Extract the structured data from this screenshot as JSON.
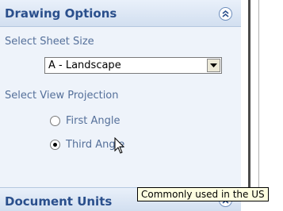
{
  "panel": {
    "title": "Drawing Options",
    "sheet_size": {
      "label": "Select Sheet Size",
      "selected": "A - Landscape"
    },
    "view_projection": {
      "label": "Select View Projection",
      "options": [
        {
          "label": "First Angle",
          "checked": false
        },
        {
          "label": "Third Angle",
          "checked": true
        }
      ]
    }
  },
  "units_panel": {
    "title": "Document Units"
  },
  "tooltip": {
    "text": "Commonly used in the US"
  },
  "icons": {
    "collapse": "chevron-double-up-icon",
    "dropdown": "triangle-down-icon",
    "cursor": "arrow-pointer-icon"
  }
}
